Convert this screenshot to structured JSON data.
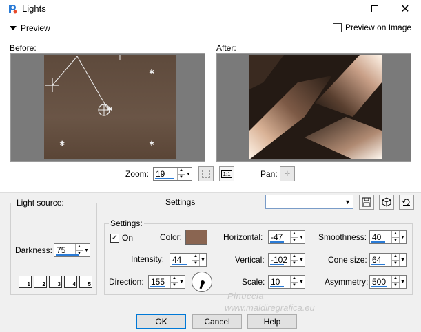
{
  "window": {
    "title": "Lights"
  },
  "preview": {
    "label": "Preview",
    "preview_on_image_label": "Preview on Image",
    "preview_on_image_checked": false
  },
  "panes": {
    "before_label": "Before:",
    "after_label": "After:"
  },
  "zoom": {
    "label": "Zoom:",
    "value": "19"
  },
  "pan": {
    "label": "Pan:"
  },
  "settings_header": {
    "label": "Settings",
    "preset_value": ""
  },
  "light_source": {
    "title": "Light source:",
    "darkness_label": "Darkness:",
    "darkness_value": "75",
    "buttons": [
      "1",
      "2",
      "3",
      "4",
      "5"
    ]
  },
  "settings": {
    "title": "Settings:",
    "on_label": "On",
    "on_checked": true,
    "color_label": "Color:",
    "color_value": "#8a6551",
    "intensity_label": "Intensity:",
    "intensity_value": "44",
    "direction_label": "Direction:",
    "direction_value": "155",
    "horizontal_label": "Horizontal:",
    "horizontal_value": "-47",
    "vertical_label": "Vertical:",
    "vertical_value": "-102",
    "scale_label": "Scale:",
    "scale_value": "10",
    "smoothness_label": "Smoothness:",
    "smoothness_value": "40",
    "cone_size_label": "Cone size:",
    "cone_size_value": "64",
    "asymmetry_label": "Asymmetry:",
    "asymmetry_value": "500"
  },
  "buttons": {
    "ok": "OK",
    "cancel": "Cancel",
    "help": "Help"
  },
  "watermark": {
    "line1": "Pinuccia",
    "line2": "www.maldiregrafica.eu"
  },
  "colors": {
    "accent": "#2a7bd6",
    "ok_border": "#0078d7",
    "light_color": "#8a6551"
  }
}
